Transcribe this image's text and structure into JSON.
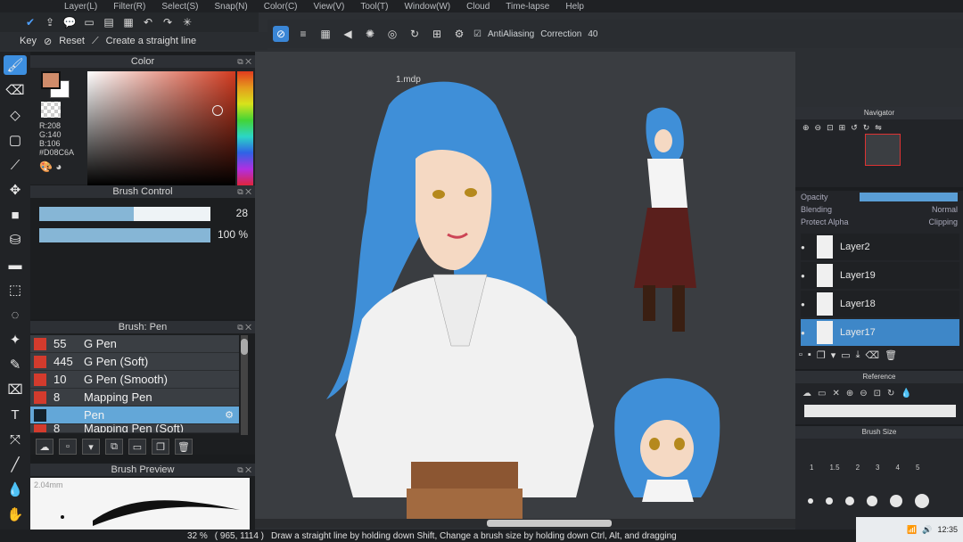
{
  "menu": [
    "Layer(L)",
    "Filter(R)",
    "Select(S)",
    "Snap(N)",
    "Color(C)",
    "View(V)",
    "Tool(T)",
    "Window(W)",
    "Cloud",
    "Time-lapse",
    "Help"
  ],
  "options": {
    "key_label": "Key",
    "reset_label": "Reset",
    "hint": "Create a straight line"
  },
  "canvas_toolbar": {
    "antialiasing_label": "AntiAliasing",
    "correction_label": "Correction",
    "correction_value": "40"
  },
  "color_panel": {
    "title": "Color",
    "r": "R:208",
    "g": "G:140",
    "b": "B:106",
    "hex": "#D08C6A",
    "fg_color": "#D08C6A"
  },
  "brush_control": {
    "title": "Brush Control",
    "size_value": "28",
    "opacity_value": "100 %",
    "size_fill": 0.55,
    "opacity_fill": 1.0
  },
  "brush_panel": {
    "title": "Brush: Pen",
    "brushes": [
      {
        "num": "55",
        "name": "G Pen"
      },
      {
        "num": "445",
        "name": "G Pen (Soft)"
      },
      {
        "num": "10",
        "name": "G Pen (Smooth)"
      },
      {
        "num": "8",
        "name": "Mapping Pen"
      },
      {
        "num": "",
        "name": "Pen",
        "selected": true
      },
      {
        "num": "8",
        "name": "Mapping Pen (Soft)"
      }
    ]
  },
  "brush_preview": {
    "title": "Brush Preview",
    "size_label": "2.04mm"
  },
  "document": {
    "title": "1.mdp"
  },
  "layers": {
    "opacity_label": "Opacity",
    "blending_label": "Blending",
    "blending_value": "Normal",
    "protect_alpha_label": "Protect Alpha",
    "clipping_label": "Clipping",
    "items": [
      {
        "name": "Layer2"
      },
      {
        "name": "Layer19"
      },
      {
        "name": "Layer18"
      },
      {
        "name": "Layer17",
        "selected": true
      }
    ]
  },
  "navigator": {
    "title": "Navigator"
  },
  "reference": {
    "title": "Reference"
  },
  "brush_size_panel": {
    "title": "Brush Size",
    "labels": [
      "1",
      "1.5",
      "2",
      "3",
      "4",
      "5"
    ]
  },
  "status": {
    "zoom": "32 %",
    "coords": "( 965, 1114 )",
    "message": "Draw a straight line by holding down Shift, Change a brush size by holding down Ctrl, Alt, and dragging"
  },
  "clock": {
    "time": "12:35"
  }
}
